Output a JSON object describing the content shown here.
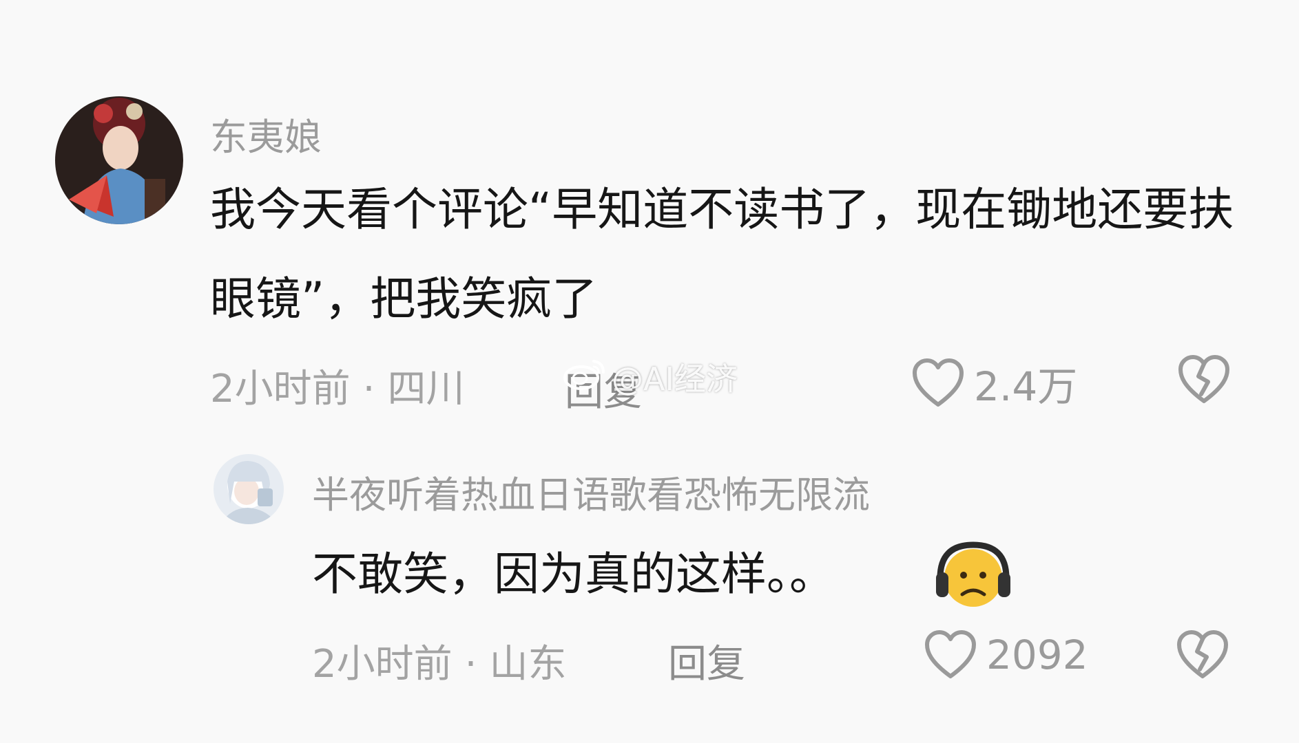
{
  "comments": [
    {
      "username": "东夷娘",
      "text": "我今天看个评论“早知道不读书了，现在锄地还要扶眼镜”，把我笑疯了",
      "time": "2小时前",
      "location": "四川",
      "reply_label": "回复",
      "likes": "2.4万"
    },
    {
      "username": "半夜听着热血日语歌看恐怖无限流",
      "text": "不敢笑，因为真的这样。。",
      "time": "2小时前",
      "location": "山东",
      "reply_label": "回复",
      "likes": "2092"
    }
  ],
  "watermark": {
    "text": "@AI经济"
  },
  "icons": {
    "like": "heart-outline-icon",
    "dislike": "broken-heart-icon",
    "emoji": "headphones-frown-emoji",
    "watermark_logo": "weibo-logo-icon"
  },
  "colors": {
    "background": "#f9f9f9",
    "text": "#161616",
    "meta": "#a3a3a3"
  }
}
